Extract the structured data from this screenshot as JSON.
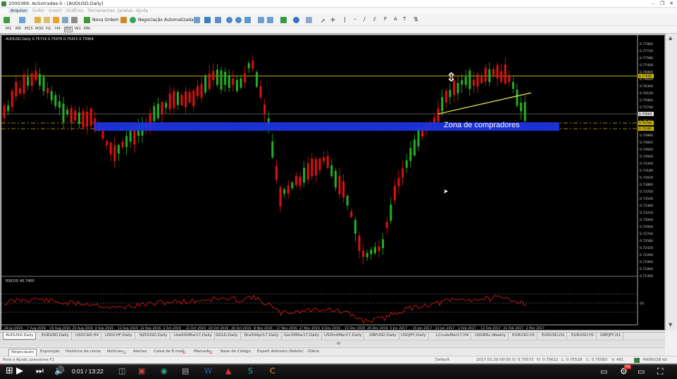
{
  "window": {
    "title": "2000389: Activtrades-5 - [AUDUSD,Daily]"
  },
  "menu": [
    "Arquivo",
    "Exibir",
    "Inserir",
    "Gráficos",
    "Ferramentas",
    "Janelas",
    "Ajuda"
  ],
  "toolbar": {
    "new_order_label": "Nova Ordem",
    "auto_trading_label": "Negociação Automatizada"
  },
  "timeframes": [
    "M1",
    "M5",
    "M15",
    "M30",
    "H1",
    "H4",
    "D1",
    "W1",
    "MN"
  ],
  "chart": {
    "header": "AUDUSD,Daily  0.75719 0.75976 0.75415 0.75964",
    "annotation": "Zona de compradores",
    "indicator_label": "RSI(10) 40.7400",
    "price_labels": [
      "0.77860",
      "0.77720",
      "0.77580",
      "0.77400",
      "0.76900",
      "0.76620",
      "0.76300",
      "0.76100",
      "0.75964",
      "0.75740",
      "0.75580",
      "0.75300",
      "0.75140",
      "0.74980",
      "0.74820",
      "0.74660",
      "0.74500",
      "0.74340",
      "0.74180",
      "0.74020",
      "0.73860",
      "0.73700",
      "0.73540",
      "0.73380",
      "0.73220",
      "0.73060",
      "0.72900",
      "0.72740",
      "0.72580",
      "0.72420",
      "0.72260",
      "0.71960",
      "0.71800",
      "0.71460"
    ],
    "highlighted_prices": [
      {
        "label": "0.77000",
        "color": "#c9b400"
      },
      {
        "label": "0.75964",
        "color": "#e0e0e0"
      },
      {
        "label": "0.75740",
        "color": "#c9b400"
      },
      {
        "label": "0.75580",
        "color": "#c9b400"
      }
    ],
    "rsi_levels": [
      "70",
      "50",
      "30"
    ],
    "date_labels": [
      "28 Jul 2016",
      "7 Aug 2016",
      "16 Aug 2016",
      "25 Aug 2016",
      "4 Sep 2016",
      "13 Sep 2016",
      "22 Sep 2016",
      "2 Oct 2016",
      "11 Oct 2016",
      "20 Oct 2016",
      "30 Oct 2016",
      "8 Nov 2016",
      "17 Nov 2016",
      "27 Nov 2016",
      "6 Dec 2016",
      "15 Dec 2016",
      "26 Dec 2016",
      "5 Jan 2017",
      "15 Jan 2017",
      "24 Jan 2017",
      "2 Feb 2017",
      "12 Feb 2017",
      "21 Feb 2017",
      "2 Mar 2017"
    ],
    "colors": {
      "bull": "#22b222",
      "bear": "#e01010",
      "zone": "#1b35e6",
      "line": "#c9b400",
      "trend": "#f2e85a"
    }
  },
  "symbol_tabs": [
    "AUDUSD,Daily",
    "EURUSD,Daily",
    "USDCAD,H4",
    "USDCHF,Daily",
    "NZDUSD,Daily",
    "Usa500Mar17,Daily",
    "GOLD,Daily",
    "Bra50Apr17,Daily",
    "Ger30Mar17,Daily",
    "USDIndMar17,Daily",
    "GBPUSD,Daily",
    "USDJPY,Daily",
    "LCrudeMar17,H4",
    "USDBRL,Weekly",
    "EURUSD,H1",
    "EURUSD,H1",
    "EURUSD,H1",
    "GBPJPY,H1"
  ],
  "terminal_tabs": [
    "Negociação",
    "Exposição",
    "Histórico da conta",
    "Notícias",
    "Alertas",
    "Caixa de E-mail",
    "Mercado",
    "Base de Código",
    "Expert Advisors (Robôs)",
    "Diário"
  ],
  "terminal_badges": {
    "news": "11",
    "email": "21",
    "market": "31"
  },
  "status": {
    "help": "Para o Ajuda, pressione F1",
    "profile": "Default",
    "datetime": "2017.01.29 00:00",
    "open": "O: 0.75573",
    "high": "H: 0.75612",
    "low": "L: 0.75528",
    "close": "C: 0.75583",
    "volume": "V: 491",
    "traffic": "49060/28 kb"
  },
  "video": {
    "time": "0:01 / 13:22",
    "progress": 0.0013
  }
}
